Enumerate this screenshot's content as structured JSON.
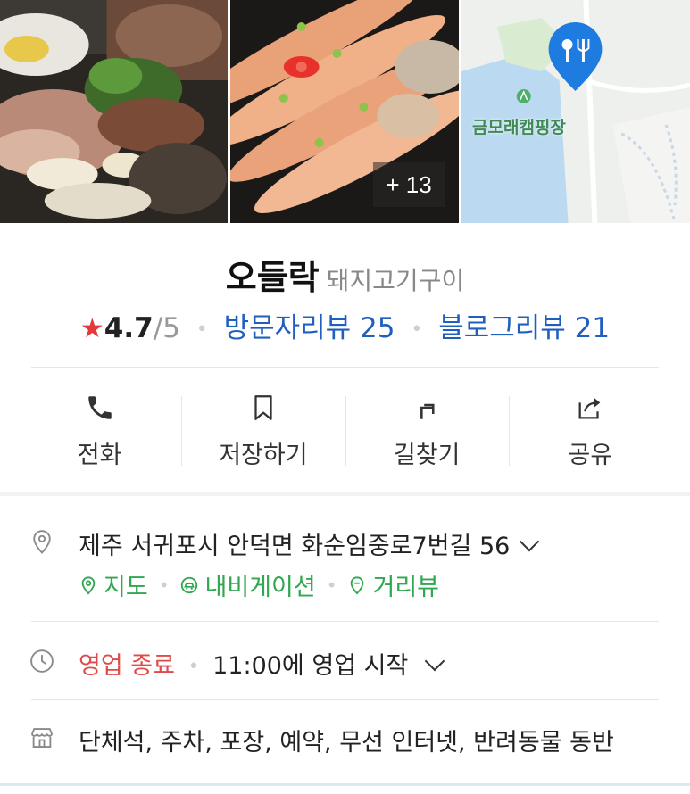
{
  "photos": {
    "more_count": "+ 13",
    "map_label": "금모래캠핑장",
    "colors": {
      "map_water": "#bcd9f2",
      "map_land": "#eef0ee",
      "map_park": "#d9ecd2",
      "pin": "#1e7be0"
    }
  },
  "place": {
    "name": "오들락",
    "category": "돼지고기구이"
  },
  "rating": {
    "star": "★",
    "value": "4.7",
    "max": "/5",
    "visitor_reviews": "방문자리뷰 25",
    "blog_reviews": "블로그리뷰 21",
    "colors": {
      "star": "#e5383b",
      "link": "#1f5fbf"
    }
  },
  "actions": [
    {
      "label": "전화",
      "icon": "phone-icon"
    },
    {
      "label": "저장하기",
      "icon": "bookmark-icon"
    },
    {
      "label": "길찾기",
      "icon": "directions-icon"
    },
    {
      "label": "공유",
      "icon": "share-icon"
    }
  ],
  "address": {
    "text": "제주 서귀포시 안덕면 화순임중로7번길 56",
    "links": [
      {
        "label": "지도",
        "icon": "map-pin-icon"
      },
      {
        "label": "내비게이션",
        "icon": "car-icon"
      },
      {
        "label": "거리뷰",
        "icon": "street-view-icon"
      }
    ],
    "link_color": "#2fa84f"
  },
  "hours": {
    "status": "영업 종료",
    "detail": "11:00에 영업 시작",
    "status_color": "#e04a4a"
  },
  "amenities": {
    "text": "단체석, 주차, 포장, 예약, 무선 인터넷, 반려동물 동반"
  }
}
